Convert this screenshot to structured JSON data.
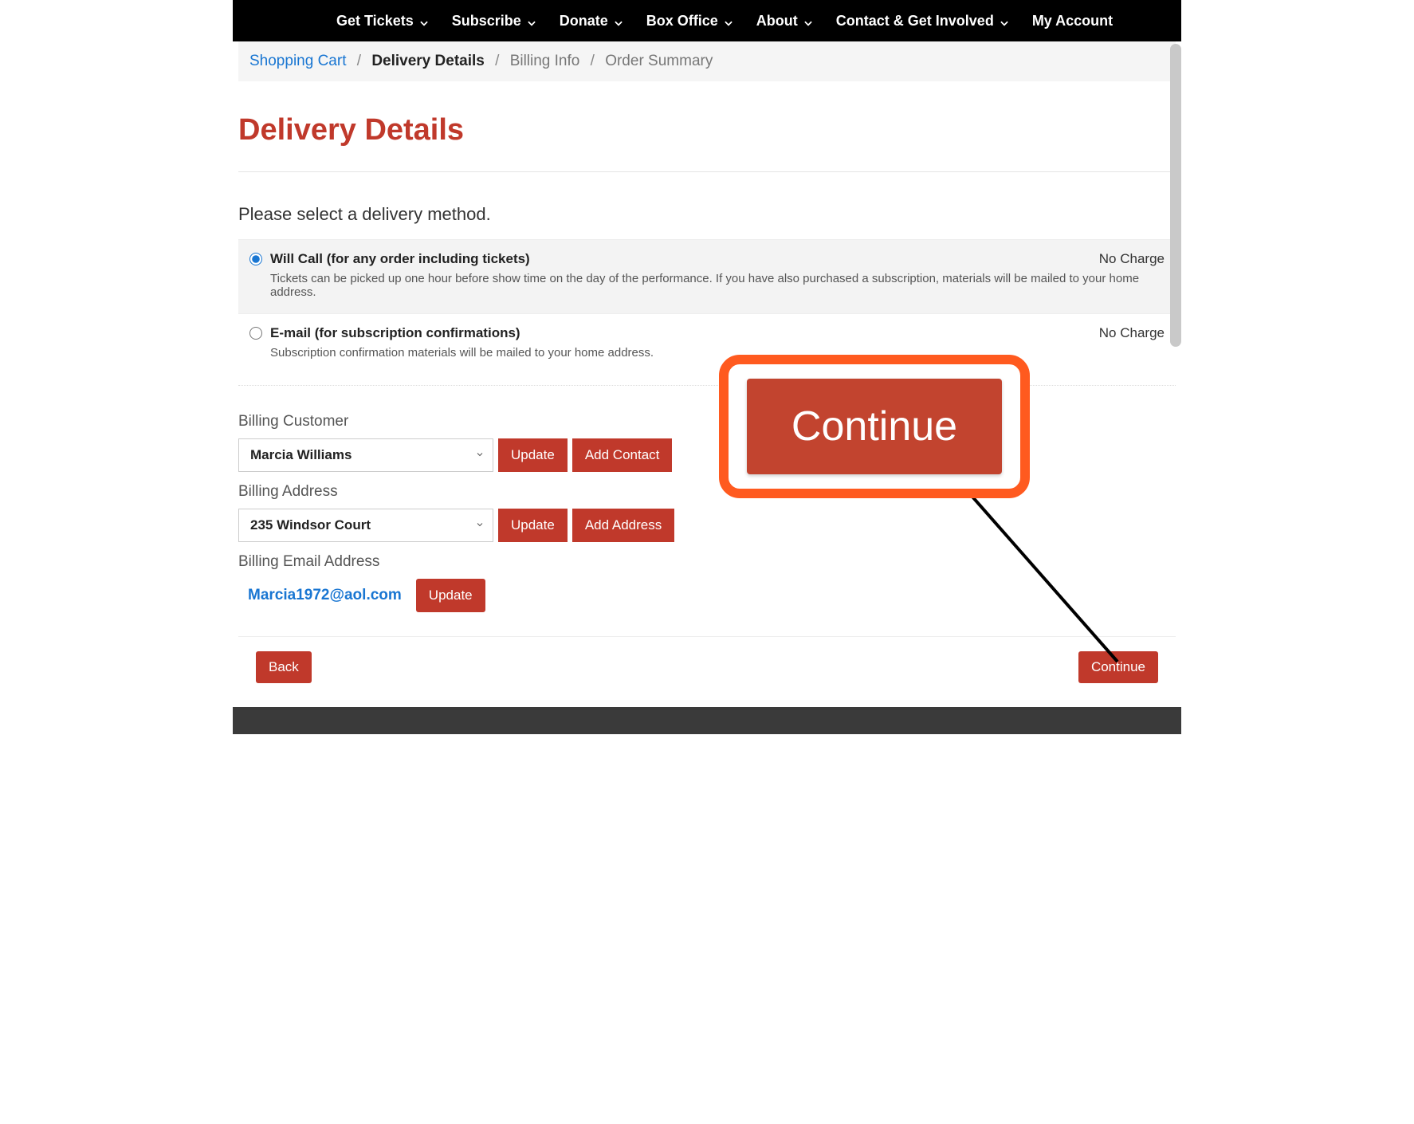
{
  "nav": {
    "items": [
      {
        "label": "Get Tickets",
        "dropdown": true
      },
      {
        "label": "Subscribe",
        "dropdown": true
      },
      {
        "label": "Donate",
        "dropdown": true
      },
      {
        "label": "Box Office",
        "dropdown": true
      },
      {
        "label": "About",
        "dropdown": true
      },
      {
        "label": "Contact & Get Involved",
        "dropdown": true
      },
      {
        "label": "My Account",
        "dropdown": false
      }
    ]
  },
  "breadcrumb": {
    "items": [
      {
        "label": "Shopping Cart",
        "state": "link"
      },
      {
        "label": "Delivery Details",
        "state": "active"
      },
      {
        "label": "Billing Info",
        "state": "dim"
      },
      {
        "label": "Order Summary",
        "state": "dim"
      }
    ]
  },
  "page": {
    "title": "Delivery Details",
    "instruction": "Please select a delivery method.",
    "methods": [
      {
        "id": "willcall",
        "label": "Will Call (for any order including tickets)",
        "desc": "Tickets can be picked up one hour before show time on the day of the performance. If you have also purchased a subscription, materials will be mailed to your home address.",
        "charge": "No Charge",
        "selected": true
      },
      {
        "id": "email",
        "label": "E-mail (for subscription confirmations)",
        "desc": "Subscription confirmation materials will be mailed to your home address.",
        "charge": "No Charge",
        "selected": false
      }
    ],
    "billing": {
      "customer": {
        "label": "Billing Customer",
        "value": "Marcia Williams",
        "update": "Update",
        "add": "Add Contact"
      },
      "address": {
        "label": "Billing Address",
        "value": "235 Windsor Court",
        "update": "Update",
        "add": "Add Address"
      },
      "email": {
        "label": "Billing Email Address",
        "value": "Marcia1972@aol.com",
        "update": "Update"
      }
    },
    "footer": {
      "back": "Back",
      "continue": "Continue"
    },
    "callout_continue": "Continue"
  },
  "colors": {
    "brand_red": "#c0392b",
    "highlight_orange": "#ff5a1f",
    "link_blue": "#1976d2"
  }
}
